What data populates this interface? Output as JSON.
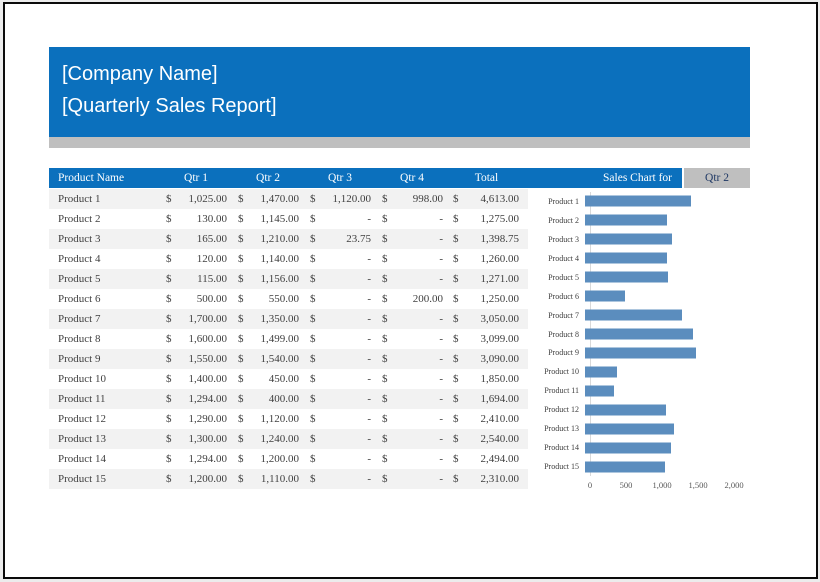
{
  "header": {
    "company_name": "[Company Name]",
    "report_title": "[Quarterly Sales Report]"
  },
  "colors": {
    "primary_blue": "#0b70bd",
    "shadow_gray": "#bfbfbf",
    "row_stripe": "#f2f2f2",
    "bar_blue": "#5b8dbe",
    "selector_text": "#1f3864"
  },
  "table": {
    "columns": [
      "Product Name",
      "Qtr 1",
      "Qtr 2",
      "Qtr 3",
      "Qtr 4",
      "Total"
    ],
    "currency_symbol": "$",
    "rows": [
      {
        "name": "Product 1",
        "qtr1": "1,025.00",
        "qtr2": "1,470.00",
        "qtr3": "1,120.00",
        "qtr4": "998.00",
        "total": "4,613.00"
      },
      {
        "name": "Product 2",
        "qtr1": "130.00",
        "qtr2": "1,145.00",
        "qtr3": "-",
        "qtr4": "-",
        "total": "1,275.00"
      },
      {
        "name": "Product 3",
        "qtr1": "165.00",
        "qtr2": "1,210.00",
        "qtr3": "23.75",
        "qtr4": "-",
        "total": "1,398.75"
      },
      {
        "name": "Product 4",
        "qtr1": "120.00",
        "qtr2": "1,140.00",
        "qtr3": "-",
        "qtr4": "-",
        "total": "1,260.00"
      },
      {
        "name": "Product 5",
        "qtr1": "115.00",
        "qtr2": "1,156.00",
        "qtr3": "-",
        "qtr4": "-",
        "total": "1,271.00"
      },
      {
        "name": "Product 6",
        "qtr1": "500.00",
        "qtr2": "550.00",
        "qtr3": "-",
        "qtr4": "200.00",
        "total": "1,250.00"
      },
      {
        "name": "Product 7",
        "qtr1": "1,700.00",
        "qtr2": "1,350.00",
        "qtr3": "-",
        "qtr4": "-",
        "total": "3,050.00"
      },
      {
        "name": "Product 8",
        "qtr1": "1,600.00",
        "qtr2": "1,499.00",
        "qtr3": "-",
        "qtr4": "-",
        "total": "3,099.00"
      },
      {
        "name": "Product 9",
        "qtr1": "1,550.00",
        "qtr2": "1,540.00",
        "qtr3": "-",
        "qtr4": "-",
        "total": "3,090.00"
      },
      {
        "name": "Product 10",
        "qtr1": "1,400.00",
        "qtr2": "450.00",
        "qtr3": "-",
        "qtr4": "-",
        "total": "1,850.00"
      },
      {
        "name": "Product 11",
        "qtr1": "1,294.00",
        "qtr2": "400.00",
        "qtr3": "-",
        "qtr4": "-",
        "total": "1,694.00"
      },
      {
        "name": "Product 12",
        "qtr1": "1,290.00",
        "qtr2": "1,120.00",
        "qtr3": "-",
        "qtr4": "-",
        "total": "2,410.00"
      },
      {
        "name": "Product 13",
        "qtr1": "1,300.00",
        "qtr2": "1,240.00",
        "qtr3": "-",
        "qtr4": "-",
        "total": "2,540.00"
      },
      {
        "name": "Product 14",
        "qtr1": "1,294.00",
        "qtr2": "1,200.00",
        "qtr3": "-",
        "qtr4": "-",
        "total": "2,494.00"
      },
      {
        "name": "Product 15",
        "qtr1": "1,200.00",
        "qtr2": "1,110.00",
        "qtr3": "-",
        "qtr4": "-",
        "total": "2,310.00"
      }
    ]
  },
  "chart": {
    "header_label": "Sales Chart for",
    "selected_quarter": "Qtr 2"
  },
  "chart_data": {
    "type": "bar",
    "orientation": "horizontal",
    "title": "Sales Chart for Qtr 2",
    "categories": [
      "Product 1",
      "Product 2",
      "Product 3",
      "Product 4",
      "Product 5",
      "Product 6",
      "Product 7",
      "Product 8",
      "Product 9",
      "Product 10",
      "Product 11",
      "Product 12",
      "Product 13",
      "Product 14",
      "Product 15"
    ],
    "series": [
      {
        "name": "Qtr 2",
        "values": [
          1470,
          1145,
          1210,
          1140,
          1156,
          550,
          1350,
          1499,
          1540,
          450,
          400,
          1120,
          1240,
          1200,
          1110
        ]
      }
    ],
    "xlim": [
      0,
      2000
    ],
    "x_ticks": [
      "0",
      "500",
      "1,000",
      "1,500",
      "2,000"
    ],
    "grid": false,
    "legend": false,
    "bar_color": "#5b8dbe"
  }
}
